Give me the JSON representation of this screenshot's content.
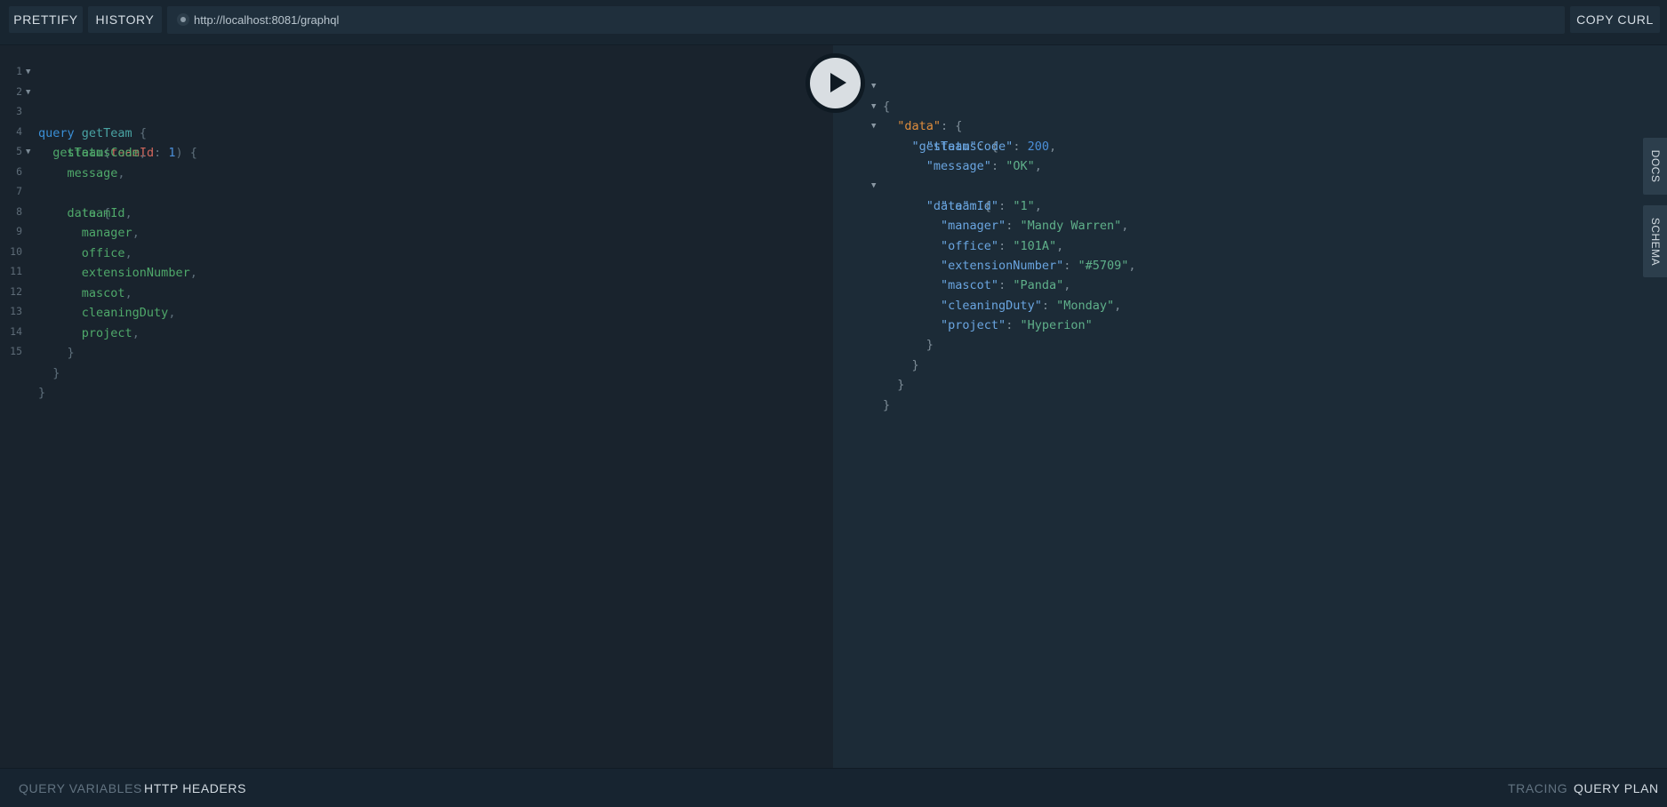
{
  "toolbar": {
    "prettify_label": "PRETTIFY",
    "history_label": "HISTORY",
    "endpoint_url": "http://localhost:8081/graphql",
    "copy_curl_label": "COPY CURL"
  },
  "query_editor": {
    "line_numbers": [
      "1",
      "2",
      "3",
      "4",
      "5",
      "6",
      "7",
      "8",
      "9",
      "10",
      "11",
      "12",
      "13",
      "14",
      "15"
    ],
    "lines": [
      {
        "text": "query getTeam {"
      },
      {
        "text": "getTeam(teamId: 1) {"
      },
      {
        "text": "statusCode,"
      },
      {
        "text": "message,"
      },
      {
        "text": "data {"
      },
      {
        "text": "teamId,"
      },
      {
        "text": "manager,"
      },
      {
        "text": "office,"
      },
      {
        "text": "extensionNumber,"
      },
      {
        "text": "mascot,"
      },
      {
        "text": "cleaningDuty,"
      },
      {
        "text": "project,"
      },
      {
        "text": "}"
      },
      {
        "text": "}"
      },
      {
        "text": "}"
      }
    ]
  },
  "result": {
    "data_key": "\"data\"",
    "getTeam_key": "\"getTeam\"",
    "statusCode_key": "\"statusCode\"",
    "statusCode_value": "200",
    "message_key": "\"message\"",
    "message_value": "\"OK\"",
    "inner_data_key": "\"data\"",
    "fields": [
      {
        "key": "\"teamId\"",
        "value": "\"1\""
      },
      {
        "key": "\"manager\"",
        "value": "\"Mandy Warren\""
      },
      {
        "key": "\"office\"",
        "value": "\"101A\""
      },
      {
        "key": "\"extensionNumber\"",
        "value": "\"#5709\""
      },
      {
        "key": "\"mascot\"",
        "value": "\"Panda\""
      },
      {
        "key": "\"cleaningDuty\"",
        "value": "\"Monday\""
      },
      {
        "key": "\"project\"",
        "value": "\"Hyperion\""
      }
    ]
  },
  "side_tabs": {
    "docs_label": "DOCS",
    "schema_label": "SCHEMA"
  },
  "bottom_bar": {
    "query_variables_label": "QUERY VARIABLES",
    "http_headers_label": "HTTP HEADERS",
    "tracing_label": "TRACING",
    "query_plan_label": "QUERY PLAN"
  }
}
